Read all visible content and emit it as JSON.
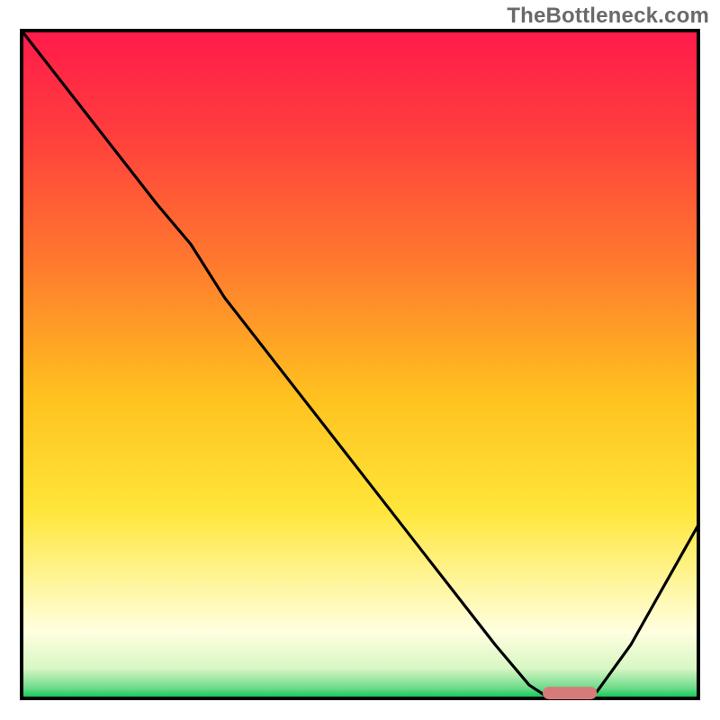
{
  "watermark": "TheBottleneck.com",
  "chart_data": {
    "type": "line",
    "title": "",
    "xlabel": "",
    "ylabel": "",
    "xlim": [
      0,
      100
    ],
    "ylim": [
      0,
      100
    ],
    "grid": false,
    "legend": false,
    "curve_note": "Single black curve showing bottleneck percentage; minimum near x≈78-84",
    "x": [
      0,
      10,
      20,
      25,
      30,
      40,
      50,
      60,
      70,
      75,
      78,
      82,
      85,
      90,
      95,
      100
    ],
    "values": [
      100,
      87,
      74,
      68,
      60,
      47,
      34,
      21,
      8,
      2,
      0,
      0,
      1,
      8,
      17,
      26
    ],
    "gradient_stops": [
      {
        "pos": 0.0,
        "color": "#ff1a4b"
      },
      {
        "pos": 0.15,
        "color": "#ff3d3d"
      },
      {
        "pos": 0.35,
        "color": "#ff7a2e"
      },
      {
        "pos": 0.55,
        "color": "#ffc21f"
      },
      {
        "pos": 0.72,
        "color": "#ffe63a"
      },
      {
        "pos": 0.84,
        "color": "#fff7a8"
      },
      {
        "pos": 0.9,
        "color": "#ffffe0"
      },
      {
        "pos": 0.955,
        "color": "#d8f7c4"
      },
      {
        "pos": 0.985,
        "color": "#6cda89"
      },
      {
        "pos": 1.0,
        "color": "#00c853"
      }
    ],
    "marker": {
      "note": "Rounded horizontal bar at curve minimum",
      "x_start": 77,
      "x_end": 85,
      "y": 0.8,
      "color": "#d77a7a"
    },
    "frame": {
      "stroke": "#000000",
      "stroke_width": 4
    }
  }
}
